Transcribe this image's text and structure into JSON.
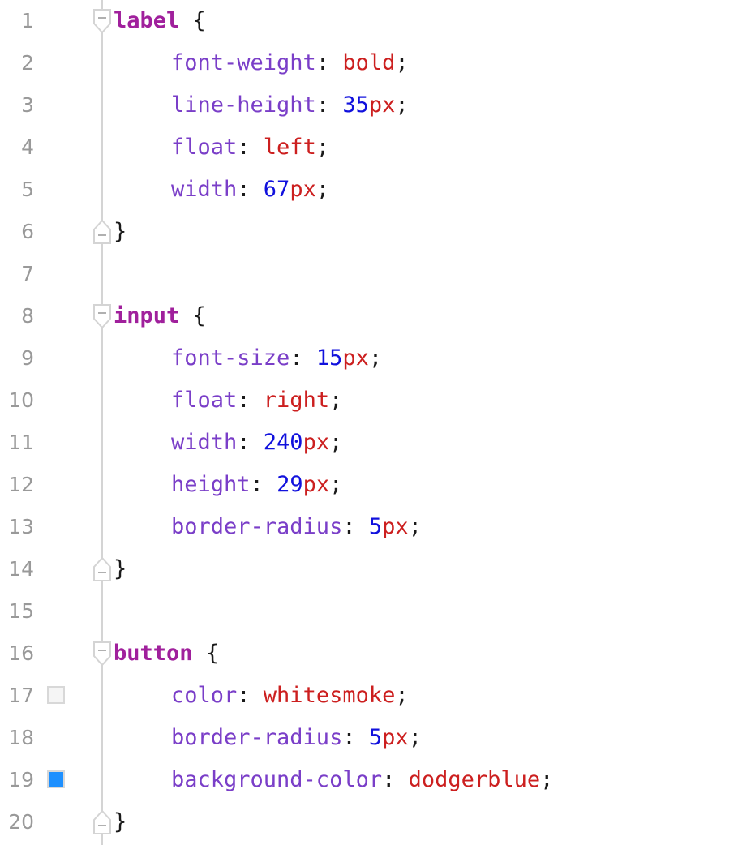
{
  "editor": {
    "language": "css",
    "background_color": "#ffffff",
    "gutter": {
      "line_number_color": "#999999",
      "fold_rail_color": "#d4d4d4",
      "swatch_border_color": "#d8d8d8"
    },
    "syntax_colors": {
      "selector": "#a0209c",
      "property": "#7a3ec8",
      "keyword_value": "#cc1f1f",
      "number": "#1111dd",
      "unit": "#cc1f1f",
      "punctuation": "#1a1a1a"
    },
    "lines": [
      {
        "number": "1",
        "fold": "open",
        "swatch": null,
        "indent": false,
        "tokens": [
          {
            "t": "selector",
            "v": "label"
          },
          {
            "t": "punct",
            "v": " "
          },
          {
            "t": "brace",
            "v": "{"
          }
        ]
      },
      {
        "number": "2",
        "fold": null,
        "swatch": null,
        "indent": true,
        "tokens": [
          {
            "t": "prop",
            "v": "font-weight"
          },
          {
            "t": "punct",
            "v": ": "
          },
          {
            "t": "keyword",
            "v": "bold"
          },
          {
            "t": "semi",
            "v": ";"
          }
        ]
      },
      {
        "number": "3",
        "fold": null,
        "swatch": null,
        "indent": true,
        "tokens": [
          {
            "t": "prop",
            "v": "line-height"
          },
          {
            "t": "punct",
            "v": ": "
          },
          {
            "t": "number",
            "v": "35"
          },
          {
            "t": "unit",
            "v": "px"
          },
          {
            "t": "semi",
            "v": ";"
          }
        ]
      },
      {
        "number": "4",
        "fold": null,
        "swatch": null,
        "indent": true,
        "tokens": [
          {
            "t": "prop",
            "v": "float"
          },
          {
            "t": "punct",
            "v": ": "
          },
          {
            "t": "keyword",
            "v": "left"
          },
          {
            "t": "semi",
            "v": ";"
          }
        ]
      },
      {
        "number": "5",
        "fold": null,
        "swatch": null,
        "indent": true,
        "tokens": [
          {
            "t": "prop",
            "v": "width"
          },
          {
            "t": "punct",
            "v": ": "
          },
          {
            "t": "number",
            "v": "67"
          },
          {
            "t": "unit",
            "v": "px"
          },
          {
            "t": "semi",
            "v": ";"
          }
        ]
      },
      {
        "number": "6",
        "fold": "close",
        "swatch": null,
        "indent": false,
        "tokens": [
          {
            "t": "brace",
            "v": "}"
          }
        ]
      },
      {
        "number": "7",
        "fold": null,
        "swatch": null,
        "indent": false,
        "tokens": []
      },
      {
        "number": "8",
        "fold": "open",
        "swatch": null,
        "indent": false,
        "tokens": [
          {
            "t": "selector",
            "v": "input"
          },
          {
            "t": "punct",
            "v": " "
          },
          {
            "t": "brace",
            "v": "{"
          }
        ]
      },
      {
        "number": "9",
        "fold": null,
        "swatch": null,
        "indent": true,
        "tokens": [
          {
            "t": "prop",
            "v": "font-size"
          },
          {
            "t": "punct",
            "v": ": "
          },
          {
            "t": "number",
            "v": "15"
          },
          {
            "t": "unit",
            "v": "px"
          },
          {
            "t": "semi",
            "v": ";"
          }
        ]
      },
      {
        "number": "10",
        "fold": null,
        "swatch": null,
        "indent": true,
        "tokens": [
          {
            "t": "prop",
            "v": "float"
          },
          {
            "t": "punct",
            "v": ": "
          },
          {
            "t": "keyword",
            "v": "right"
          },
          {
            "t": "semi",
            "v": ";"
          }
        ]
      },
      {
        "number": "11",
        "fold": null,
        "swatch": null,
        "indent": true,
        "tokens": [
          {
            "t": "prop",
            "v": "width"
          },
          {
            "t": "punct",
            "v": ": "
          },
          {
            "t": "number",
            "v": "240"
          },
          {
            "t": "unit",
            "v": "px"
          },
          {
            "t": "semi",
            "v": ";"
          }
        ]
      },
      {
        "number": "12",
        "fold": null,
        "swatch": null,
        "indent": true,
        "tokens": [
          {
            "t": "prop",
            "v": "height"
          },
          {
            "t": "punct",
            "v": ": "
          },
          {
            "t": "number",
            "v": "29"
          },
          {
            "t": "unit",
            "v": "px"
          },
          {
            "t": "semi",
            "v": ";"
          }
        ]
      },
      {
        "number": "13",
        "fold": null,
        "swatch": null,
        "indent": true,
        "tokens": [
          {
            "t": "prop",
            "v": "border-radius"
          },
          {
            "t": "punct",
            "v": ": "
          },
          {
            "t": "number",
            "v": "5"
          },
          {
            "t": "unit",
            "v": "px"
          },
          {
            "t": "semi",
            "v": ";"
          }
        ]
      },
      {
        "number": "14",
        "fold": "close",
        "swatch": null,
        "indent": false,
        "tokens": [
          {
            "t": "brace",
            "v": "}"
          }
        ]
      },
      {
        "number": "15",
        "fold": null,
        "swatch": null,
        "indent": false,
        "tokens": []
      },
      {
        "number": "16",
        "fold": "open",
        "swatch": null,
        "indent": false,
        "tokens": [
          {
            "t": "selector",
            "v": "button"
          },
          {
            "t": "punct",
            "v": " "
          },
          {
            "t": "brace",
            "v": "{"
          }
        ]
      },
      {
        "number": "17",
        "fold": null,
        "swatch": "#f5f5f5",
        "indent": true,
        "tokens": [
          {
            "t": "prop",
            "v": "color"
          },
          {
            "t": "punct",
            "v": ": "
          },
          {
            "t": "keyword",
            "v": "whitesmoke"
          },
          {
            "t": "semi",
            "v": ";"
          }
        ]
      },
      {
        "number": "18",
        "fold": null,
        "swatch": null,
        "indent": true,
        "tokens": [
          {
            "t": "prop",
            "v": "border-radius"
          },
          {
            "t": "punct",
            "v": ": "
          },
          {
            "t": "number",
            "v": "5"
          },
          {
            "t": "unit",
            "v": "px"
          },
          {
            "t": "semi",
            "v": ";"
          }
        ]
      },
      {
        "number": "19",
        "fold": null,
        "swatch": "#1e90ff",
        "indent": true,
        "tokens": [
          {
            "t": "prop",
            "v": "background-color"
          },
          {
            "t": "punct",
            "v": ": "
          },
          {
            "t": "keyword",
            "v": "dodgerblue"
          },
          {
            "t": "semi",
            "v": ";"
          }
        ]
      },
      {
        "number": "20",
        "fold": "close",
        "swatch": null,
        "indent": false,
        "tokens": [
          {
            "t": "brace",
            "v": "}"
          }
        ]
      }
    ]
  }
}
